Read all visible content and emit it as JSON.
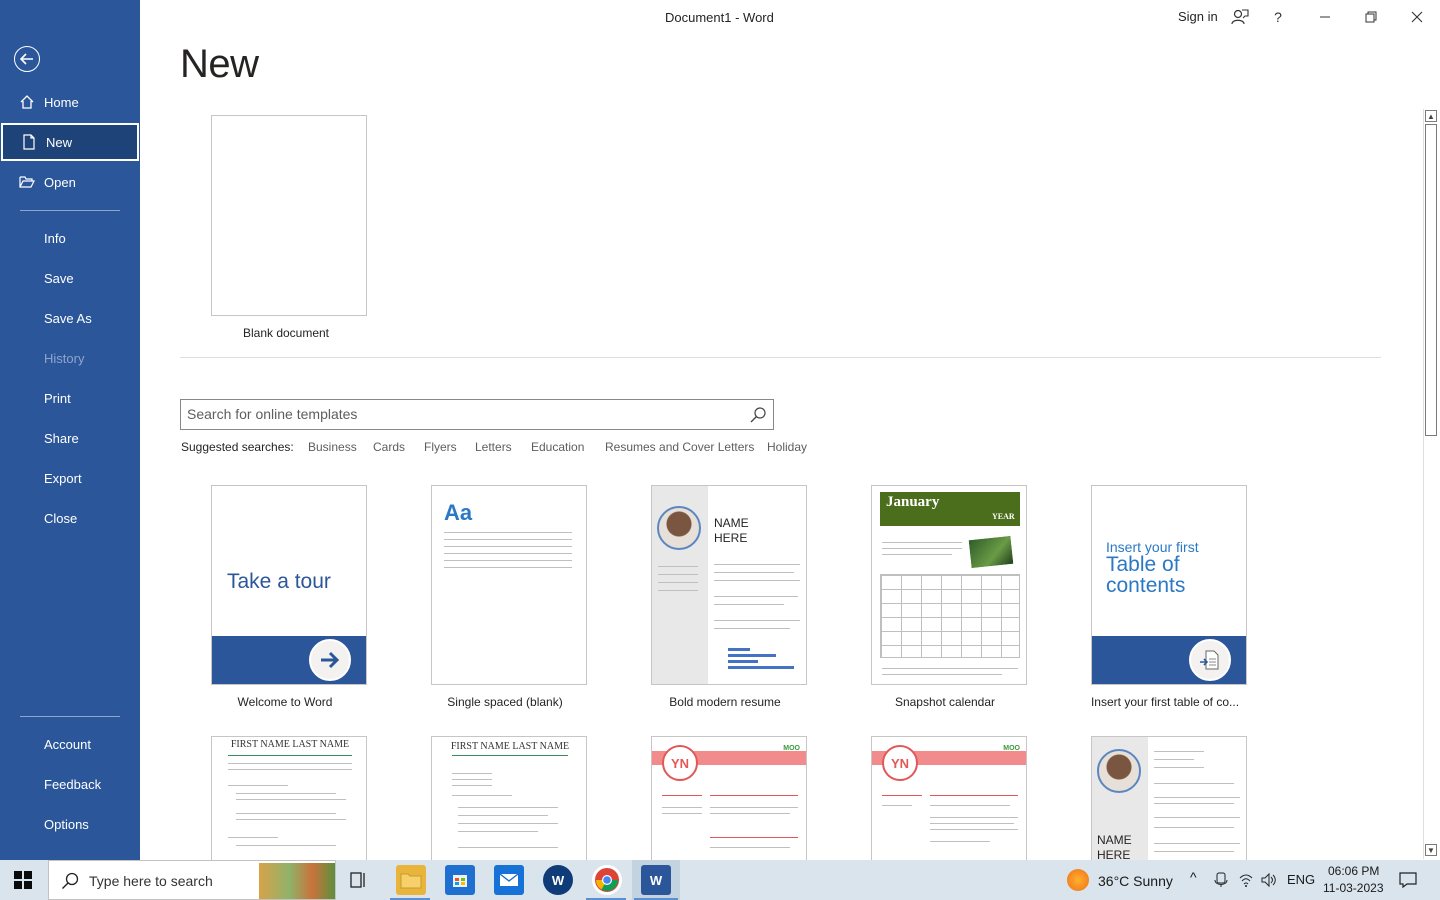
{
  "window": {
    "title": "Document1  -  Word",
    "sign_in": "Sign in",
    "help": "?"
  },
  "sidebar": {
    "items": [
      {
        "label": "Home"
      },
      {
        "label": "New"
      },
      {
        "label": "Open"
      },
      {
        "label": "Info"
      },
      {
        "label": "Save"
      },
      {
        "label": "Save As"
      },
      {
        "label": "History"
      },
      {
        "label": "Print"
      },
      {
        "label": "Share"
      },
      {
        "label": "Export"
      },
      {
        "label": "Close"
      },
      {
        "label": "Account"
      },
      {
        "label": "Feedback"
      },
      {
        "label": "Options"
      }
    ],
    "selected": "New"
  },
  "main": {
    "title": "New",
    "blank_label": "Blank document",
    "search": {
      "placeholder": "Search for online templates"
    },
    "suggested": {
      "label": "Suggested searches:",
      "links": [
        "Business",
        "Cards",
        "Flyers",
        "Letters",
        "Education",
        "Resumes and Cover Letters",
        "Holiday"
      ]
    },
    "templates": [
      {
        "label": "Welcome to Word",
        "thumb_text": "Take a tour"
      },
      {
        "label": "Single spaced (blank)",
        "thumb_text": "Aa"
      },
      {
        "label": "Bold modern resume",
        "thumb_name_1": "NAME",
        "thumb_name_2": "HERE"
      },
      {
        "label": "Snapshot calendar",
        "thumb_month": "January",
        "thumb_year": "YEAR"
      },
      {
        "label": "Insert your first table of co...",
        "thumb_line_1": "Insert your first",
        "thumb_line_2": "Table of",
        "thumb_line_3": "contents"
      }
    ],
    "templates_row2": [
      {
        "thumb_text": "FIRST NAME LAST NAME"
      },
      {
        "thumb_text": "FIRST NAME LAST NAME"
      },
      {
        "thumb_text": "YN",
        "brand": "MOO"
      },
      {
        "thumb_text": "YN",
        "brand": "MOO"
      },
      {
        "thumb_name_1": "NAME",
        "thumb_name_2": "HERE"
      }
    ]
  },
  "taskbar": {
    "search_placeholder": "Type here to search",
    "weather": "36°C  Sunny",
    "language": "ENG",
    "time": "06:06 PM",
    "date": "11-03-2023"
  },
  "colors": {
    "accent": "#2b579a",
    "sidebar_selected": "#1e4378"
  }
}
